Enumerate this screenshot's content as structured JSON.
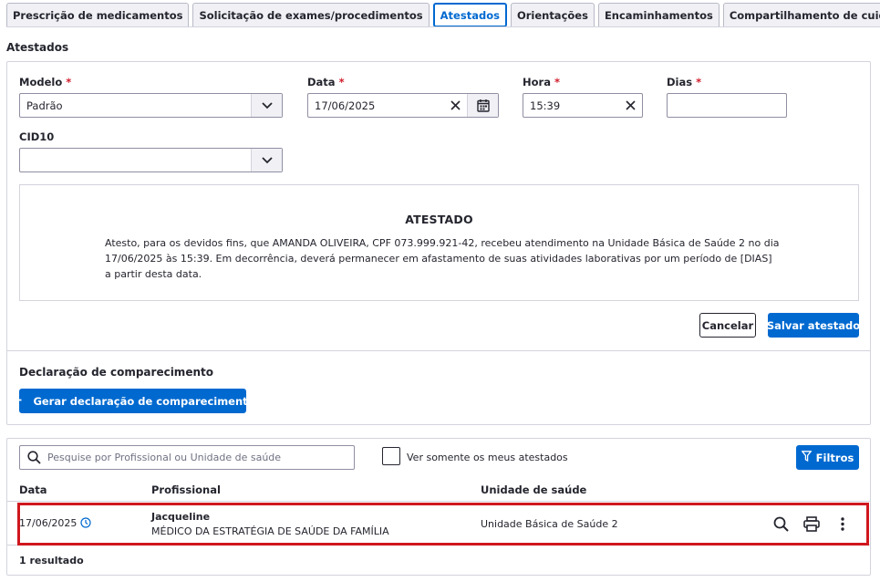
{
  "tabs": [
    {
      "label": "Prescrição de medicamentos"
    },
    {
      "label": "Solicitação de exames/procedimentos"
    },
    {
      "label": "Atestados"
    },
    {
      "label": "Orientações"
    },
    {
      "label": "Encaminhamentos"
    },
    {
      "label": "Compartilhamento de cuidado"
    }
  ],
  "active_tab": "Atestados",
  "section_title": "Atestados",
  "form": {
    "modelo": {
      "label": "Modelo",
      "value": "Padrão"
    },
    "data": {
      "label": "Data",
      "value": "17/06/2025"
    },
    "hora": {
      "label": "Hora",
      "value": "15:39"
    },
    "dias": {
      "label": "Dias",
      "value": ""
    },
    "cid10": {
      "label": "CID10",
      "value": ""
    },
    "required_mark": "*"
  },
  "preview": {
    "title": "ATESTADO",
    "body": "Atesto, para os devidos fins, que AMANDA OLIVEIRA, CPF 073.999.921-42, recebeu atendimento na Unidade Básica de Saúde 2 no dia 17/06/2025 às 15:39. Em decorrência, deverá permanecer em afastamento de suas atividades laborativas por um período de [DIAS] a partir desta data."
  },
  "actions": {
    "cancel": "Cancelar",
    "save": "Salvar atestado"
  },
  "declaracao": {
    "title": "Declaração de comparecimento",
    "button": "Gerar declaração de comparecimento"
  },
  "list": {
    "search_placeholder": "Pesquise por Profissional ou Unidade de saúde",
    "own_only_label": "Ver somente os meus atestados",
    "filters_label": "Filtros",
    "columns": [
      "Data",
      "Profissional",
      "Unidade de saúde"
    ],
    "rows": [
      {
        "date": "17/06/2025",
        "professional_name": "Jacqueline",
        "professional_role": "MÉDICO DA ESTRATÉGIA DE SAÚDE DA FAMÍLIA",
        "unit": "Unidade Básica de Saúde 2"
      }
    ],
    "result_count": "1 resultado"
  },
  "colors": {
    "primary": "#0069d0",
    "required": "#d01e2c",
    "highlight": "#d0171e",
    "border": "#d3d4dd"
  },
  "icons": [
    "chevron-down-icon",
    "close-icon",
    "calendar-icon",
    "plus-icon",
    "search-icon",
    "filter-icon",
    "clock-icon",
    "print-icon",
    "more-vertical-icon"
  ]
}
